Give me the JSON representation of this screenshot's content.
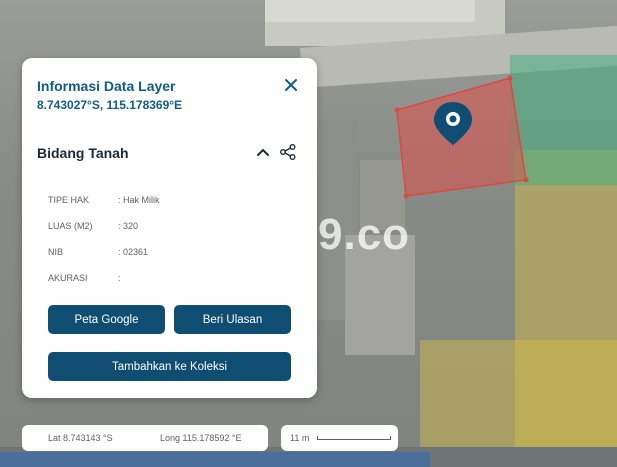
{
  "panel": {
    "title": "Informasi Data Layer",
    "coordinates": "8.743027°S, 115.178369°E",
    "close_icon": "close-icon",
    "section_title": "Bidang Tanah",
    "collapse_icon": "chevron-up-icon",
    "share_icon": "share-icon",
    "attributes": [
      {
        "key": "TIPE HAK",
        "value": ": Hak Milik"
      },
      {
        "key": "LUAS (M2)",
        "value": ": 320"
      },
      {
        "key": "NIB",
        "value": ": 02361"
      },
      {
        "key": "AKURASI",
        "value": ":"
      }
    ],
    "buttons": {
      "google": "Peta Google",
      "review": "Beri Ulasan",
      "collection": "Tambahkan ke Koleksi"
    }
  },
  "status": {
    "lat": "Lat 8.743143 °S",
    "long": "Long 115.178592 °E",
    "scale": "11 m"
  },
  "map": {
    "watermark": "9.co",
    "marker_icon": "location-pin-icon"
  },
  "colors": {
    "accent": "#0f4d73",
    "title": "#0f5c86",
    "parcel_red": "#e0504a",
    "parcel_green": "#46af82",
    "parcel_yellow": "#d7be46"
  }
}
